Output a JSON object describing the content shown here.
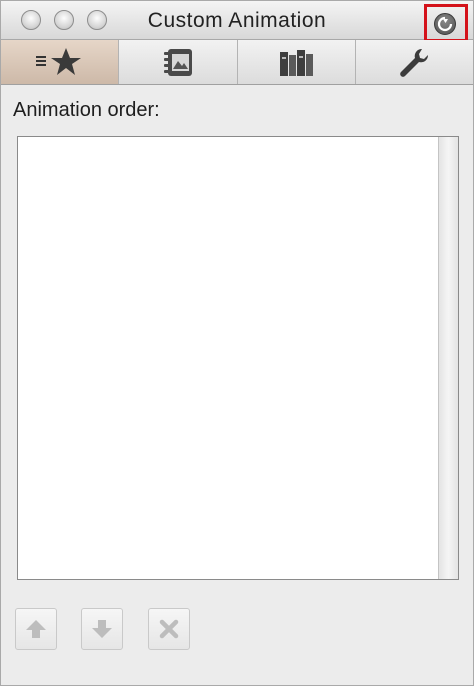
{
  "window": {
    "title": "Custom Animation"
  },
  "toolbar": {
    "tabs": [
      {
        "icon": "animation-star-icon",
        "active": true
      },
      {
        "icon": "slide-notebook-icon",
        "active": false
      },
      {
        "icon": "books-library-icon",
        "active": false
      },
      {
        "icon": "wrench-icon",
        "active": false
      }
    ]
  },
  "content": {
    "animation_order_label": "Animation order:"
  },
  "colors": {
    "highlight": "#d4121a",
    "active_tab": "#d8c6b6",
    "window_bg": "#ececec"
  }
}
